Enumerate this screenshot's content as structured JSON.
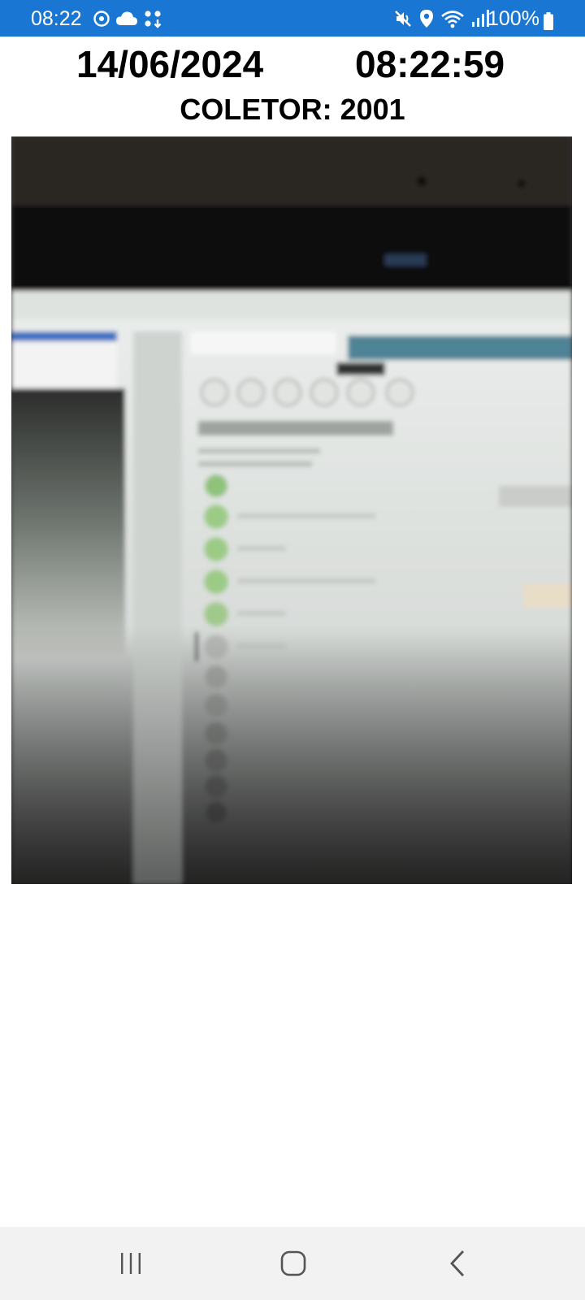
{
  "status_bar": {
    "time": "08:22",
    "battery": "100%",
    "left_icons": [
      "sync-icon",
      "cloud-icon",
      "apps-download-icon"
    ],
    "right_icons": [
      "mute-icon",
      "location-icon",
      "wifi-icon",
      "signal-icon",
      "battery-icon"
    ]
  },
  "header": {
    "date": "14/06/2024",
    "time": "08:22:59",
    "collector_label": "COLETOR: 2001"
  },
  "camera_preview": {
    "content": "camera-feed"
  },
  "navigation": {
    "buttons": [
      "recent-apps-icon",
      "home-icon",
      "back-icon"
    ]
  },
  "colors": {
    "status_bar": "#1976d2",
    "background": "#ffffff",
    "nav_bar": "#f2f2f2"
  }
}
